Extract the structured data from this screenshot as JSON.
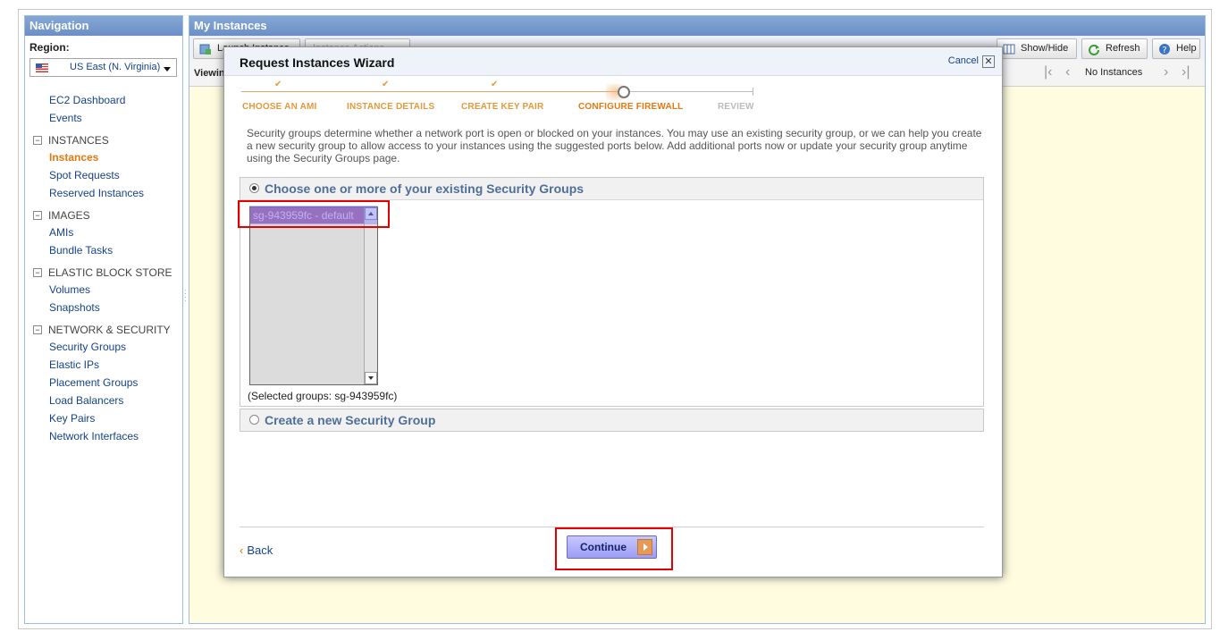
{
  "navigation": {
    "title": "Navigation",
    "region_label": "Region:",
    "region_value": "US East (N. Virginia)",
    "top_items": [
      "EC2 Dashboard",
      "Events"
    ],
    "sections": [
      {
        "title": "INSTANCES",
        "items": [
          "Instances",
          "Spot Requests",
          "Reserved Instances"
        ]
      },
      {
        "title": "IMAGES",
        "items": [
          "AMIs",
          "Bundle Tasks"
        ]
      },
      {
        "title": "ELASTIC BLOCK STORE",
        "items": [
          "Volumes",
          "Snapshots"
        ]
      },
      {
        "title": "NETWORK & SECURITY",
        "items": [
          "Security Groups",
          "Elastic IPs",
          "Placement Groups",
          "Load Balancers",
          "Key Pairs",
          "Network Interfaces"
        ]
      }
    ],
    "active_item": "Instances"
  },
  "main": {
    "title": "My Instances",
    "toolbar": {
      "launch_label": "Launch Instance",
      "actions_label": "Instance Actions",
      "showhide_label": "Show/Hide",
      "refresh_label": "Refresh",
      "help_label": "Help"
    },
    "viewing_label": "Viewing:",
    "pager_text": "No Instances"
  },
  "wizard": {
    "title": "Request Instances Wizard",
    "cancel_label": "Cancel",
    "close_symbol": "✕",
    "steps": [
      {
        "label": "CHOOSE AN AMI",
        "state": "done"
      },
      {
        "label": "INSTANCE DETAILS",
        "state": "done"
      },
      {
        "label": "CREATE KEY PAIR",
        "state": "done"
      },
      {
        "label": "CONFIGURE FIREWALL",
        "state": "current"
      },
      {
        "label": "REVIEW",
        "state": "future"
      }
    ],
    "intro": "Security groups determine whether a network port is open or blocked on your instances. You may use an existing security group, or we can help you create a new security group to allow access to your instances using the suggested ports below. Add additional ports now or update your security group anytime using the Security Groups page.",
    "existing_option": "Choose one or more of your existing Security Groups",
    "existing_selected": true,
    "groups": [
      "sg-943959fc - default"
    ],
    "selected_groups_text": "(Selected groups: sg-943959fc)",
    "create_option": "Create a new Security Group",
    "back_label": "Back",
    "continue_label": "Continue"
  },
  "colors": {
    "header_blue": "#6b8fc6",
    "link_blue": "#15428b",
    "accent_orange": "#e47911",
    "main_bg": "#fffce0",
    "highlight_red": "#e30000"
  },
  "icons": {
    "flag": "us-flag-icon",
    "dropdown": "chevron-down-icon",
    "close": "close-icon",
    "continue_arrow": "arrow-right-icon"
  }
}
